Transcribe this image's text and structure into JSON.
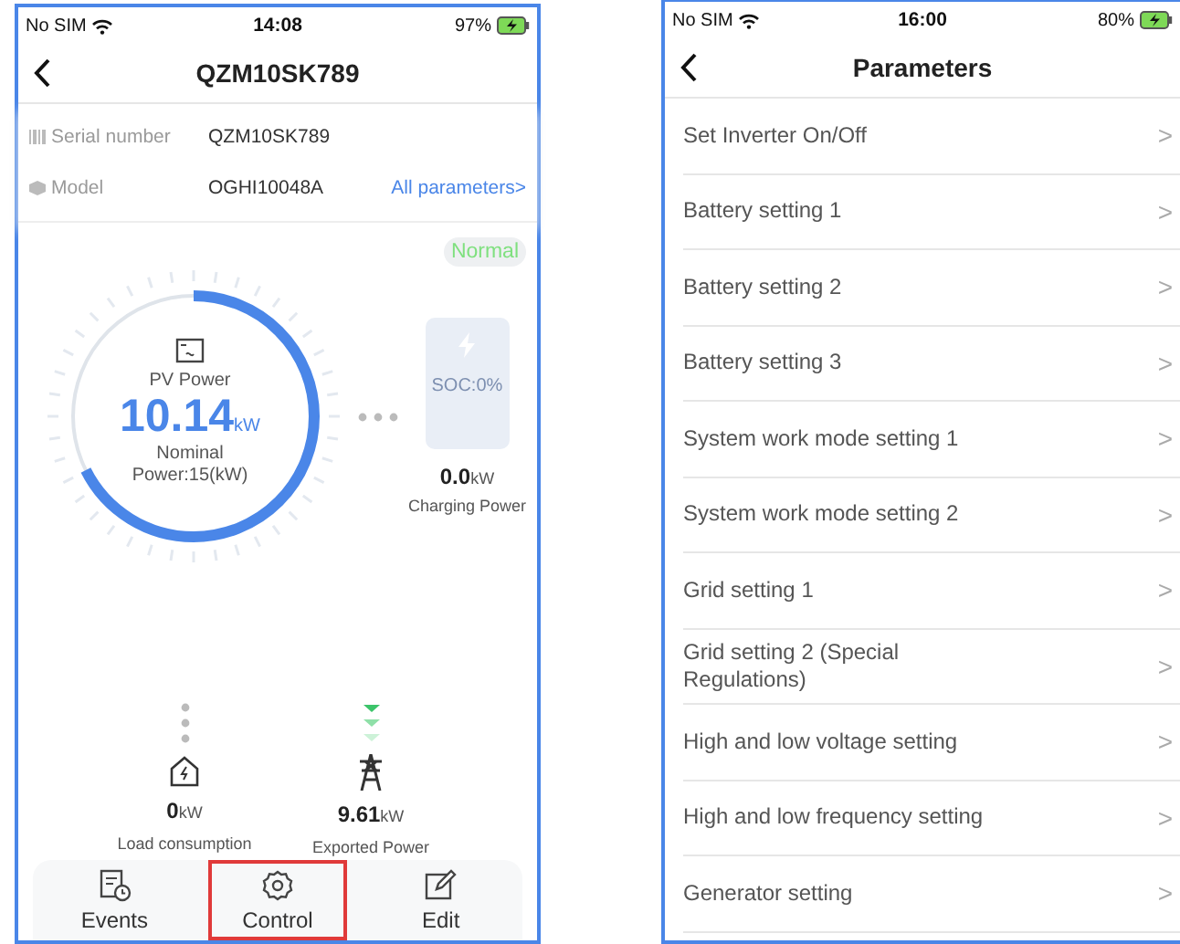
{
  "left_screen": {
    "status_bar": {
      "carrier": "No SIM",
      "time": "14:08",
      "battery": "97%"
    },
    "title": "QZM10SK789",
    "info": [
      {
        "label": "Serial number",
        "value": "QZM10SK789"
      },
      {
        "label": "Model",
        "value": "OGHI10048A"
      }
    ],
    "all_parameters_link": "All parameters>",
    "status_badge": "Normal",
    "pv": {
      "label": "PV Power",
      "value": "10.14",
      "unit": "kW",
      "nominal": "Nominal Power:15(kW)",
      "level": 0.676
    },
    "battery": {
      "soc": "SOC:0%",
      "value": "0.0",
      "unit": "kW",
      "label": "Charging Power"
    },
    "load": {
      "value": "0",
      "unit": "kW",
      "label": "Load consumption"
    },
    "grid": {
      "value": "9.61",
      "unit": "kW",
      "label": "Exported Power"
    },
    "tabs": [
      {
        "label": "Events",
        "selected": false
      },
      {
        "label": "Control",
        "selected": true
      },
      {
        "label": "Edit",
        "selected": false
      }
    ]
  },
  "right_screen": {
    "status_bar": {
      "carrier": "No SIM",
      "time": "16:00",
      "battery": "80%"
    },
    "title": "Parameters",
    "items": [
      "Set Inverter On/Off",
      "Battery setting 1",
      "Battery setting 2",
      "Battery setting 3",
      "System work mode setting 1",
      "System work mode setting 2",
      "Grid setting 1",
      "Grid setting 2 (Special Regulations)",
      "High and low voltage setting",
      "High and low frequency setting",
      "Generator setting"
    ],
    "chevron": ">"
  }
}
